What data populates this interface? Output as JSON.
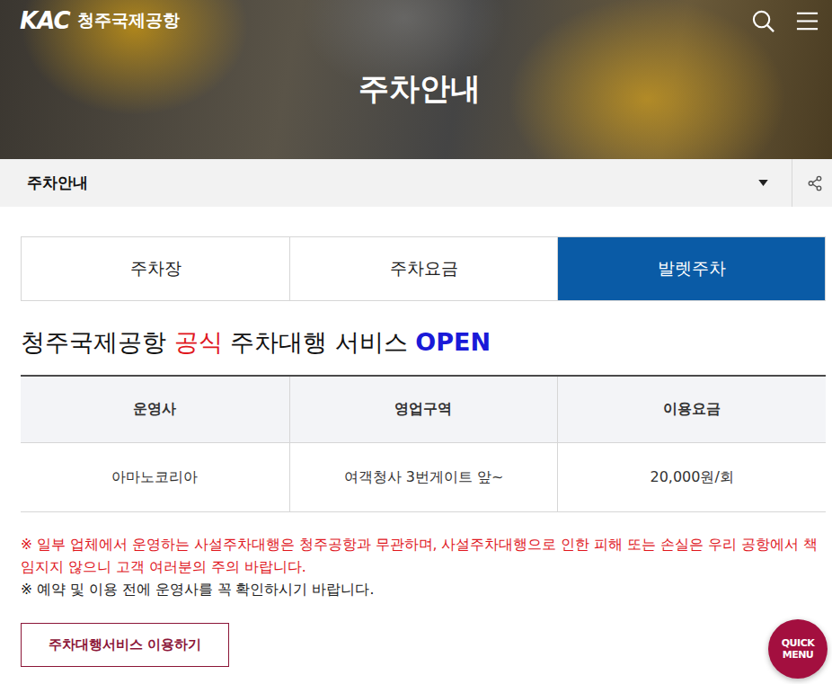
{
  "header": {
    "logo_mark": "KAC",
    "logo_text": "청주국제공항",
    "title": "주차안내"
  },
  "breadcrumb": {
    "label": "주차안내"
  },
  "tabs": [
    {
      "label": "주차장",
      "selected": false
    },
    {
      "label": "주차요금",
      "selected": false
    },
    {
      "label": "발렛주차",
      "selected": true
    }
  ],
  "heading": [
    {
      "text": "청주국제공항 ",
      "color": "#111111"
    },
    {
      "text": "공식",
      "color": "#e0161d"
    },
    {
      "text": " 주차대행 서비스 ",
      "color": "#111111"
    },
    {
      "text": "OPEN",
      "color": "#1a1ad8"
    }
  ],
  "table": {
    "columns": [
      "운영사",
      "영업구역",
      "이용요금"
    ],
    "rows": [
      [
        "아마노코리아",
        "여객청사 3번게이트 앞~",
        "20,000원/회"
      ]
    ]
  },
  "notices": [
    {
      "kind": "warning",
      "text": "※ 일부 업체에서 운영하는 사설주차대행은 청주공항과 무관하며, 사설주차대행으로 인한 피해 또는 손실은 우리 공항에서 책임지지 않으니 고객 여러분의 주의 바랍니다."
    },
    {
      "kind": "info",
      "text": "※ 예약 및 이용 전에 운영사를 꼭 확인하시기 바랍니다."
    }
  ],
  "button": {
    "label": "주차대행서비스 이용하기"
  },
  "quick_menu": [
    "QUICK",
    "MENU"
  ]
}
